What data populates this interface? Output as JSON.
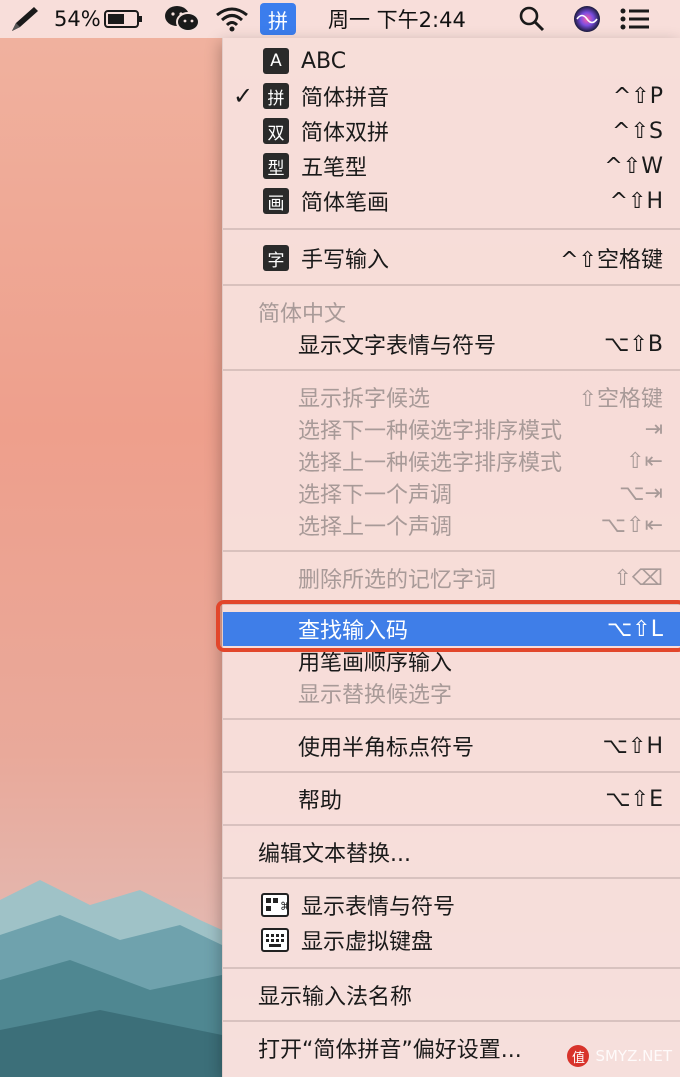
{
  "menubar": {
    "battery_percent": "54%",
    "ime_label": "拼",
    "datetime": "周一 下午2:44"
  },
  "menu": {
    "input_sources": [
      {
        "icon": "A",
        "label": "ABC",
        "shortcut": "",
        "checked": false
      },
      {
        "icon": "拼",
        "label": "简体拼音",
        "shortcut": "^⇧P",
        "checked": true,
        "check": "✓"
      },
      {
        "icon": "双",
        "label": "简体双拼",
        "shortcut": "^⇧S",
        "checked": false
      },
      {
        "icon": "型",
        "label": "五笔型",
        "shortcut": "^⇧W",
        "checked": false
      },
      {
        "icon": "画",
        "label": "简体笔画",
        "shortcut": "^⇧H",
        "checked": false
      }
    ],
    "handwriting": {
      "icon": "字",
      "label": "手写输入",
      "shortcut": "^⇧空格键"
    },
    "section_header": "简体中文",
    "show_text_emoji": {
      "label": "显示文字表情与符号",
      "shortcut": "⌥⇧B"
    },
    "disabled_group": [
      {
        "label": "显示拆字候选",
        "shortcut": "⇧空格键"
      },
      {
        "label": "选择下一种候选字排序模式",
        "shortcut": "⇥"
      },
      {
        "label": "选择上一种候选字排序模式",
        "shortcut": "⇧⇤"
      },
      {
        "label": "选择下一个声调",
        "shortcut": "⌥⇥"
      },
      {
        "label": "选择上一个声调",
        "shortcut": "⌥⇧⇤"
      }
    ],
    "delete_memory": {
      "label": "删除所选的记忆字词",
      "shortcut": "⇧⌫"
    },
    "find_code": {
      "label": "查找输入码",
      "shortcut": "⌥⇧L"
    },
    "stroke_order": {
      "label": "用笔画顺序输入"
    },
    "show_replace": {
      "label": "显示替换候选字"
    },
    "half_width": {
      "label": "使用半角标点符号",
      "shortcut": "⌥⇧H"
    },
    "help": {
      "label": "帮助",
      "shortcut": "⌥⇧E"
    },
    "edit_replace": {
      "label": "编辑文本替换..."
    },
    "show_emoji": {
      "label": "显示表情与符号"
    },
    "show_keyboard": {
      "label": "显示虚拟键盘"
    },
    "show_ime_name": {
      "label": "显示输入法名称"
    },
    "open_prefs": {
      "label": "打开“简体拼音”偏好设置..."
    }
  },
  "watermark": {
    "logo": "值",
    "text": "SMYZ.NET"
  },
  "colors": {
    "selection": "#3f7ee8",
    "highlight_ring": "#e2462b",
    "ime_box": "#3b7ded"
  }
}
